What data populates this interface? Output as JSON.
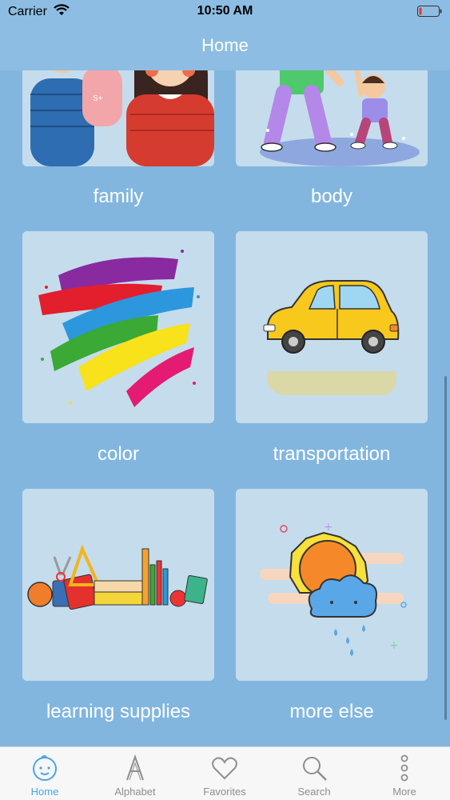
{
  "status_bar": {
    "carrier": "Carrier",
    "time": "10:50 AM"
  },
  "nav": {
    "title": "Home"
  },
  "categories": [
    {
      "label": "family"
    },
    {
      "label": "body"
    },
    {
      "label": "color"
    },
    {
      "label": "transportation"
    },
    {
      "label": "learning supplies"
    },
    {
      "label": "more else"
    }
  ],
  "tabs": [
    {
      "label": "Home",
      "icon": "baby-face-icon",
      "active": true
    },
    {
      "label": "Alphabet",
      "icon": "letter-a-icon"
    },
    {
      "label": "Favorites",
      "icon": "heart-icon"
    },
    {
      "label": "Search",
      "icon": "magnifier-icon"
    },
    {
      "label": "More",
      "icon": "more-dots-icon"
    }
  ],
  "colors": {
    "background": "#82b6df",
    "tile": "#c5dcec",
    "tab_active": "#4aa5e8",
    "tab_inactive": "#8e8e8e"
  }
}
